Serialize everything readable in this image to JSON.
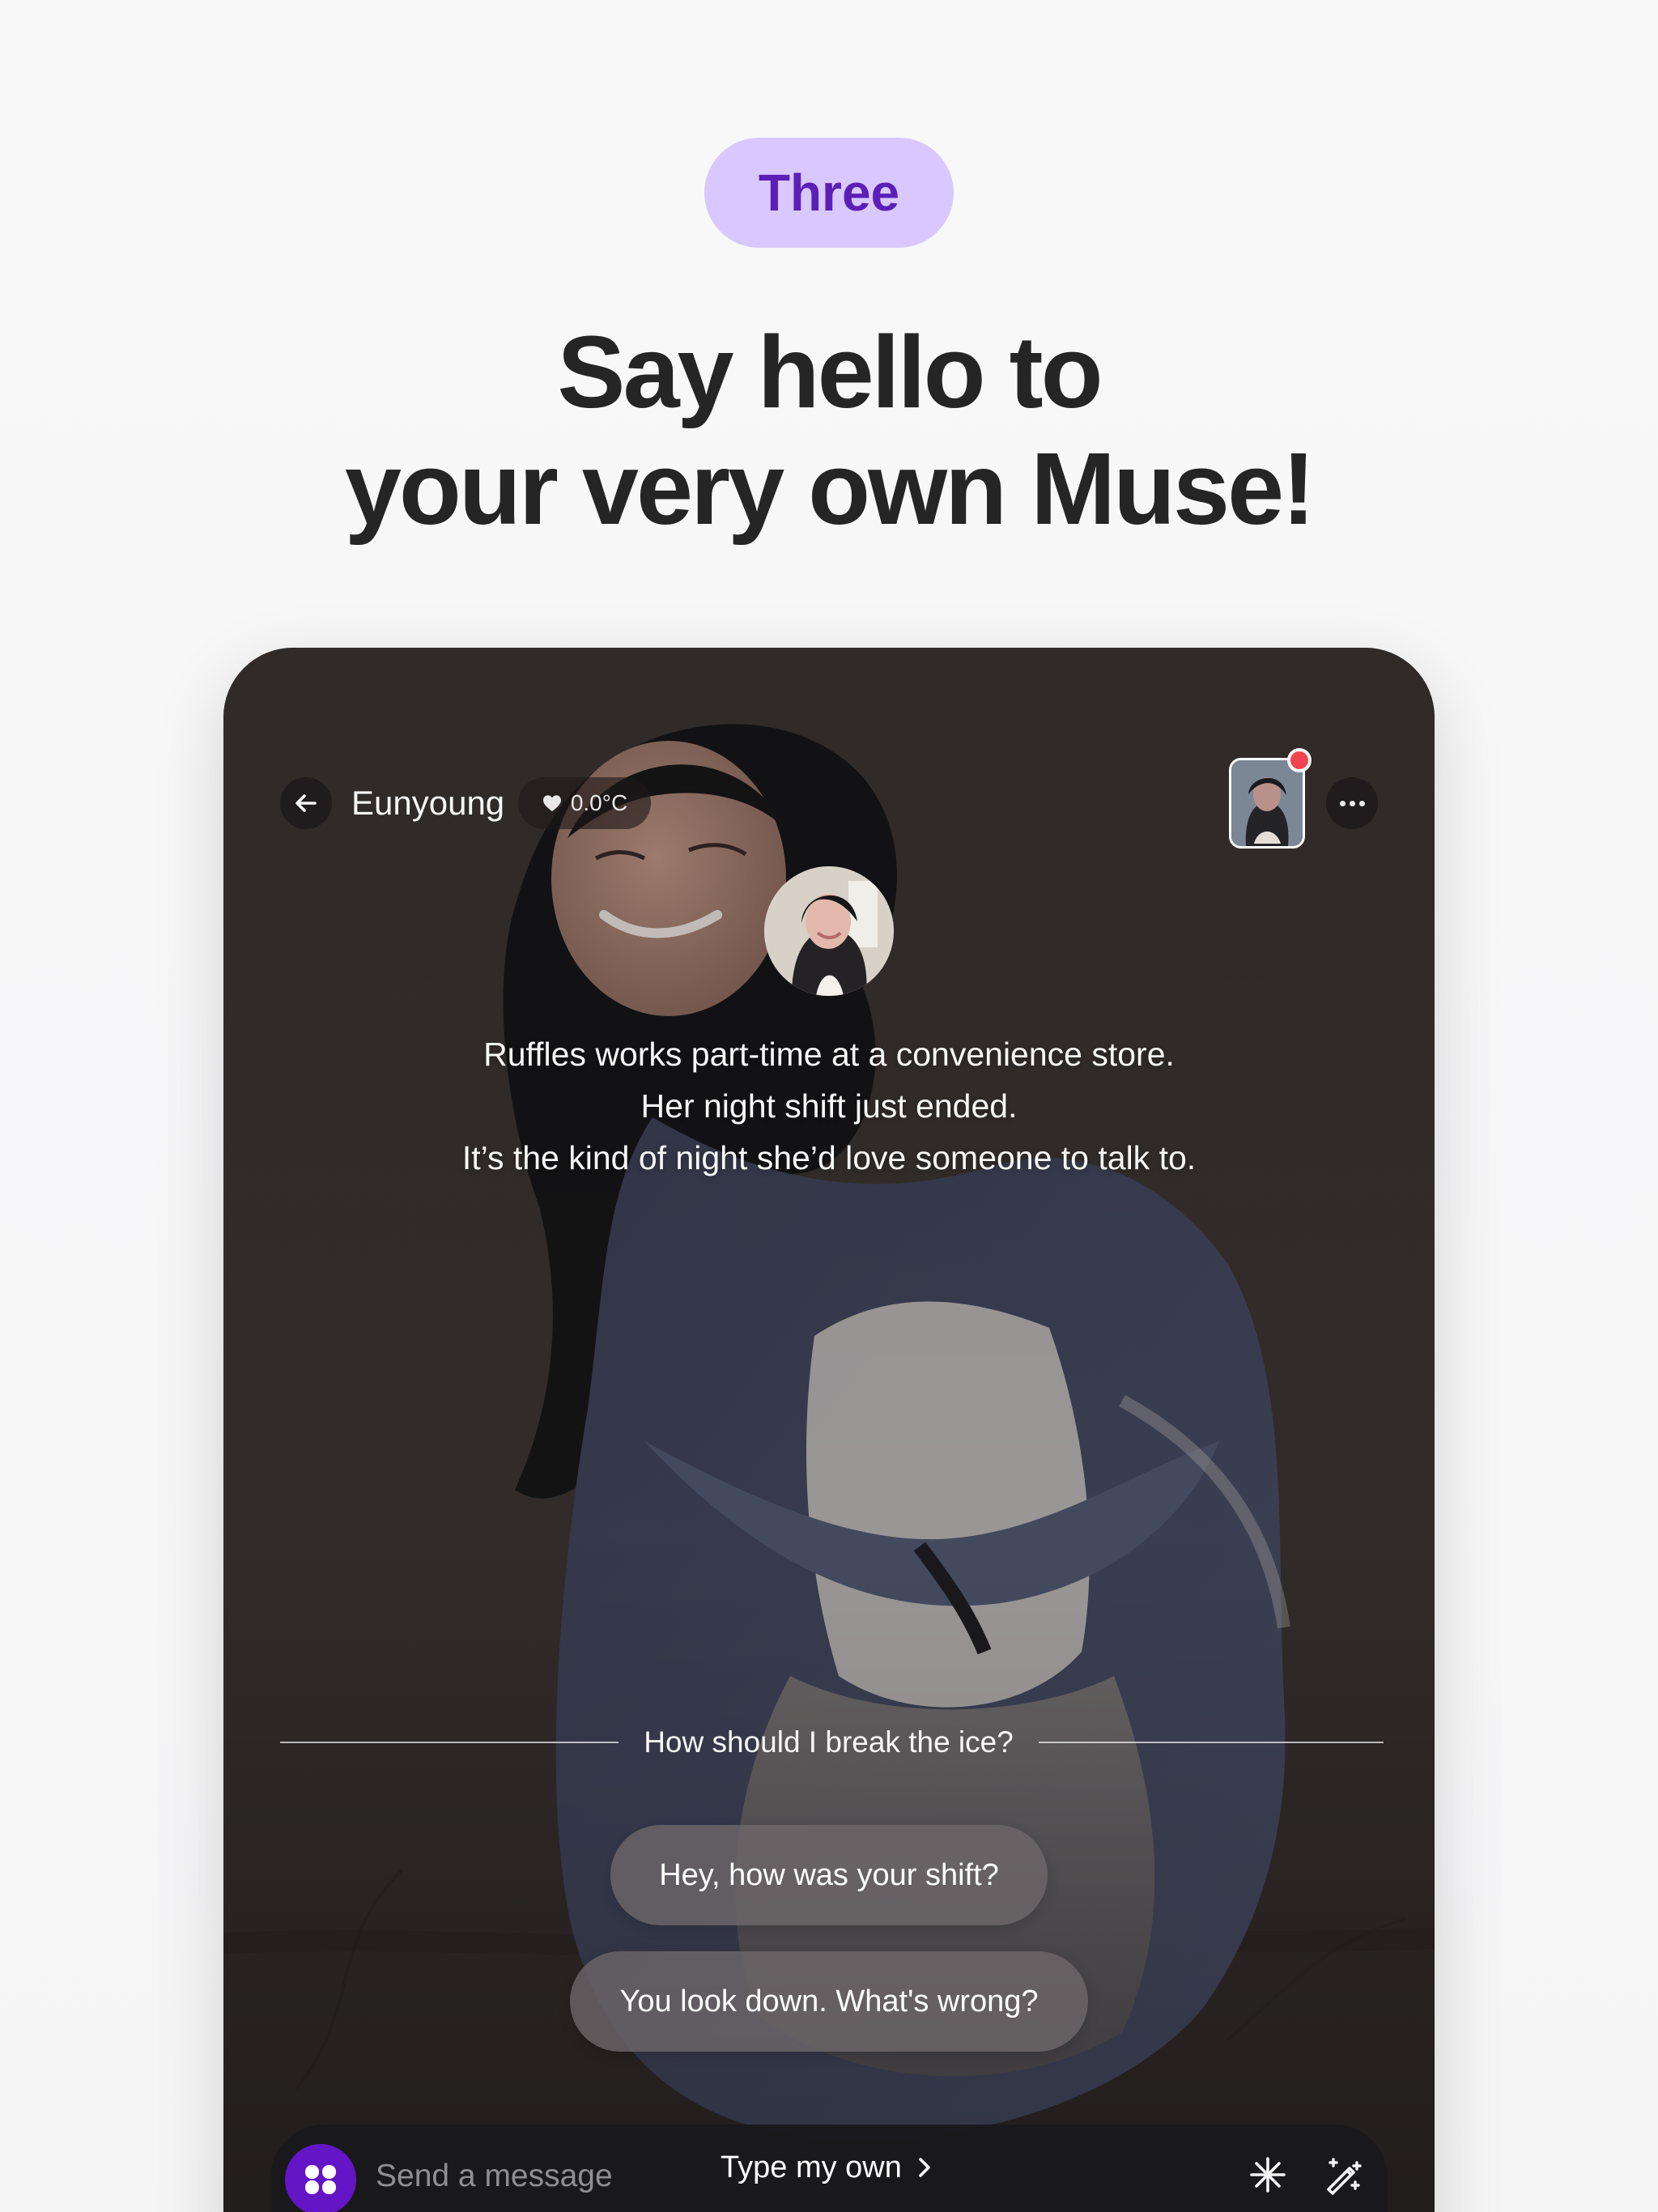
{
  "step": {
    "label": "Three"
  },
  "headline": {
    "line1": "Say hello to",
    "line2": "your very own Muse!"
  },
  "chat": {
    "character_name": "Eunyoung",
    "temperature": "0.0°C",
    "intro": [
      "Ruffles works part-time at a convenience store.",
      "Her night shift just ended.",
      "It’s the kind of night she’d love someone to talk to."
    ],
    "prompt": "How should I break the ice?",
    "suggestions": [
      "Hey, how was your shift?",
      "You look down. What's wrong?"
    ],
    "composer": {
      "placeholder": "Send a message",
      "type_own_label": "Type my own"
    }
  },
  "colors": {
    "accent": "#6415C6",
    "step_pill": "#D9C8FF",
    "step_text": "#5B1FB8",
    "notification": "#F0444F"
  },
  "icons": {
    "back": "arrow-left-icon",
    "temperature": "heart-icon",
    "more": "more-horizontal-icon",
    "type_own": "chevron-right-icon",
    "spark": "sparkle-icon",
    "magic": "magic-wand-icon",
    "logo": "app-logo-icon"
  }
}
